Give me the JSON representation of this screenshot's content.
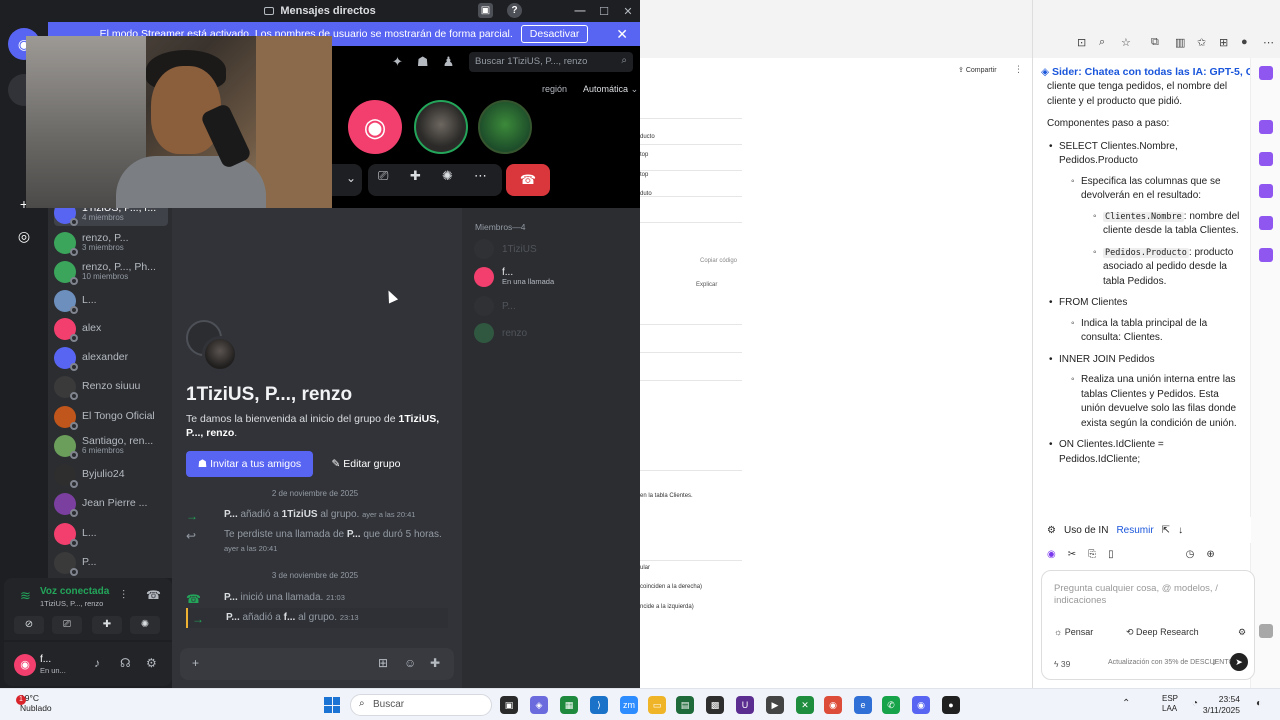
{
  "discord": {
    "window_title": "Mensajes directos",
    "streamer_banner": {
      "text": "El modo Streamer está activado. Los nombres de usuario se mostrarán de forma parcial.",
      "button": "Desactivar"
    },
    "search_placeholder": "Buscar 1TiziUS, P..., renzo",
    "region_label": "región",
    "region_value": "Automática",
    "dm_list": [
      {
        "name": "1TiziUS, P..., r...",
        "sub": "4 miembros",
        "active": true,
        "color": "#5865f2"
      },
      {
        "name": "renzo, P...",
        "sub": "3 miembros",
        "color": "#3ba55c"
      },
      {
        "name": "renzo, P..., Ph...",
        "sub": "10 miembros",
        "color": "#3ba55c"
      },
      {
        "name": "L...",
        "sub": "",
        "color": "#6d8fbd"
      },
      {
        "name": "alex",
        "sub": "",
        "color": "#f23f6e"
      },
      {
        "name": "alexander",
        "sub": "",
        "color": "#5865f2"
      },
      {
        "name": "Renzo siuuu",
        "sub": "",
        "color": "#3a3a3a"
      },
      {
        "name": "El Tongo Oficial",
        "sub": "",
        "color": "#c0561b"
      },
      {
        "name": "Santiago, ren...",
        "sub": "6 miembros",
        "color": "#6b9e5a"
      },
      {
        "name": "Byjulio24",
        "sub": "",
        "color": "#2e2e2e"
      },
      {
        "name": "Jean Pierre ...",
        "sub": "",
        "color": "#7b3fa0"
      },
      {
        "name": "L...",
        "sub": "",
        "color": "#f23f6e"
      },
      {
        "name": "P...",
        "sub": "",
        "color": "#3a3a3a"
      }
    ],
    "voice": {
      "title": "Voz conectada",
      "sub": "1TiziUS, P..., renzo"
    },
    "user": {
      "name": "f...",
      "status": "En un..."
    },
    "chat": {
      "group_title": "1TiziUS, P..., renzo",
      "welcome_prefix": "Te damos la bienvenida al inicio del grupo de",
      "welcome_names": "1TiziUS, P..., renzo",
      "invite_button": "Invitar a tus amigos",
      "edit_button": "Editar grupo",
      "date1": "2 de noviembre de 2025",
      "msg1_user": "P...",
      "msg1_mid": "añadió a",
      "msg1_target": "1TiziUS",
      "msg1_tail": "al grupo.",
      "msg1_ts": "ayer a las 20:41",
      "msg2_a": "Te perdiste una llamada de",
      "msg2_user": "P...",
      "msg2_b": "que duró 5 horas.",
      "msg2_ts": "ayer a las 20:41",
      "date2": "3 de noviembre de 2025",
      "msg3_user": "P...",
      "msg3_text": "inició una llamada.",
      "msg3_ts": "21:03",
      "msg4_user": "P...",
      "msg4_mid": "añadió a",
      "msg4_target": "f...",
      "msg4_tail": "al grupo.",
      "msg4_ts": "23:13"
    },
    "members": {
      "header": "Miembros—4",
      "list": [
        {
          "name": "1TiziUS",
          "status": "",
          "dim": true,
          "color": "#3a3a3a"
        },
        {
          "name": "f...",
          "status": "En una llamada",
          "dim": false,
          "color": "#f23f6e"
        },
        {
          "name": "P...",
          "status": "",
          "dim": true,
          "color": "#3a3a3a"
        },
        {
          "name": "renzo",
          "status": "",
          "dim": true,
          "color": "#3ba55c"
        }
      ]
    }
  },
  "middle": {
    "share": "Compartir",
    "snippets": [
      "ducto",
      "top",
      "top",
      "duto",
      "Copiar código",
      "Explicar",
      "en la tabla Clientes.",
      "ular",
      "coinciden a la derecha)",
      "ncide a la izquierda)"
    ]
  },
  "sider": {
    "title": "Sider: Chatea con todas las IA: GPT-5, C...",
    "intro": "cliente que tenga pedidos, el nombre del cliente y el producto que pidió.",
    "steps_heading": "Componentes paso a paso:",
    "b1": "SELECT Clientes.Nombre, Pedidos.Producto",
    "b1_1": "Especifica las columnas que se devolverán en el resultado:",
    "b1_1a_code": "Clientes.Nombre",
    "b1_1a_text": ": nombre del cliente desde la tabla Clientes.",
    "b1_1b_code": "Pedidos.Producto",
    "b1_1b_text": ": producto asociado al pedido desde la tabla Pedidos.",
    "b2": "FROM Clientes",
    "b2_1": "Indica la tabla principal de la consulta: Clientes.",
    "b3": "INNER JOIN Pedidos",
    "b3_1": "Realiza una unión interna entre las tablas Clientes y Pedidos. Esta unión devuelve solo las filas donde exista según la condición de unión.",
    "b4": "ON Clientes.IdCliente = Pedidos.IdCliente;",
    "toolbar_use": "Uso de IN",
    "toolbar_summary": "Resumir",
    "input_placeholder": "Pregunta cualquier cosa, @ modelos, / indicaciones",
    "think": "Pensar",
    "deep_research": "Deep Research",
    "quota": "39",
    "bottom_text": "Actualización con 35% de DESCUENTO"
  },
  "taskbar": {
    "weather_temp": "19°C",
    "weather_desc": "Nublado",
    "weather_badge": "1",
    "search": "Buscar",
    "lang1": "ESP",
    "lang2": "LAA",
    "time": "23:54",
    "date": "3/11/2025"
  }
}
